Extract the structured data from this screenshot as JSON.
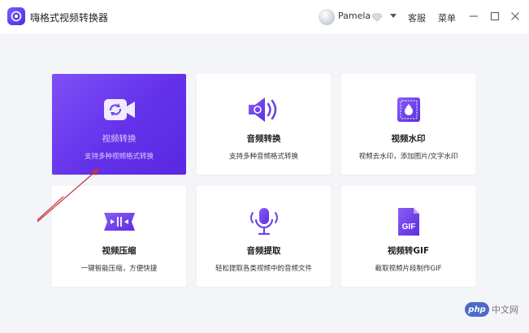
{
  "app": {
    "title": "嗨格式视频转换器"
  },
  "user": {
    "name": "Pamela"
  },
  "titlebar": {
    "support_label": "客服",
    "menu_label": "菜单"
  },
  "colors": {
    "accent": "#6a3cf0",
    "accent_light": "#7f50f7",
    "icon_purple": "#6b45e8"
  },
  "cards": [
    {
      "title": "视频转换",
      "desc": "支持多种视频格式转换",
      "icon": "video-convert-icon",
      "active": true
    },
    {
      "title": "音频转换",
      "desc": "支持多种音频格式转换",
      "icon": "audio-convert-icon",
      "active": false
    },
    {
      "title": "视频水印",
      "desc": "视频去水印，添加图片/文字水印",
      "icon": "watermark-icon",
      "active": false
    },
    {
      "title": "视频压缩",
      "desc": "一键智能压缩，方便快捷",
      "icon": "compress-icon",
      "active": false
    },
    {
      "title": "音频提取",
      "desc": "轻松提取各类视频中的音频文件",
      "icon": "microphone-icon",
      "active": false
    },
    {
      "title": "视频转GIF",
      "desc": "截取视频片段制作GIF",
      "icon": "gif-file-icon",
      "active": false
    }
  ],
  "watermark": {
    "badge": "php",
    "text": "中文网"
  }
}
